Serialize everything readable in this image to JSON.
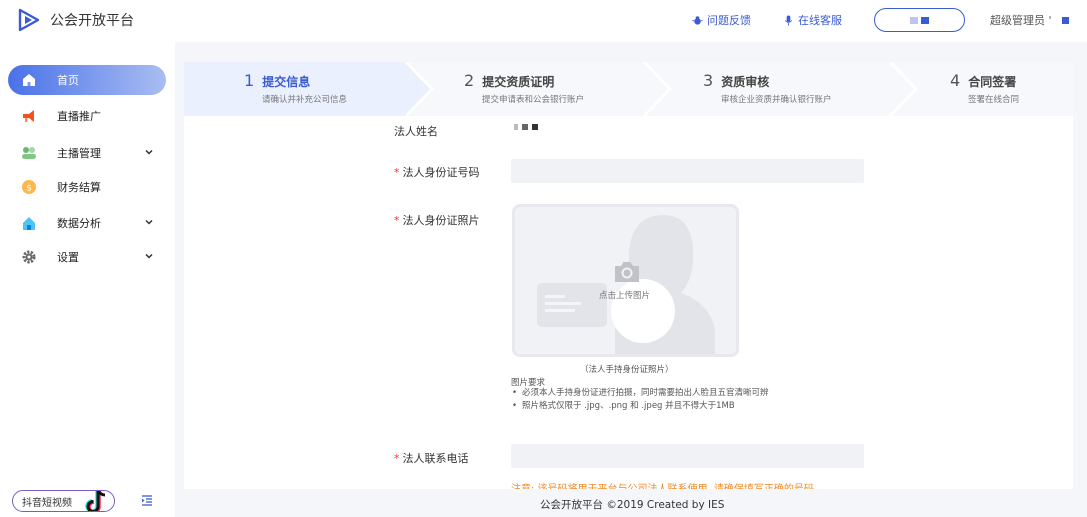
{
  "header": {
    "brand": "公会开放平台",
    "feedback": "问题反馈",
    "service": "在线客服",
    "user": "超级管理员 '"
  },
  "sidebar": {
    "items": [
      {
        "label": "首页",
        "icon": "home-icon"
      },
      {
        "label": "直播推广",
        "icon": "megaphone-icon"
      },
      {
        "label": "主播管理",
        "icon": "users-icon"
      },
      {
        "label": "财务结算",
        "icon": "coin-icon"
      },
      {
        "label": "数据分析",
        "icon": "chart-house-icon"
      },
      {
        "label": "设置",
        "icon": "gear-icon"
      }
    ],
    "douyin": "抖音短视频"
  },
  "steps": [
    {
      "num": "1",
      "title": "提交信息",
      "sub": "请确认并补充公司信息"
    },
    {
      "num": "2",
      "title": "提交资质证明",
      "sub": "提交申请表和公会银行账户"
    },
    {
      "num": "3",
      "title": "资质审核",
      "sub": "审核企业资质并确认银行账户"
    },
    {
      "num": "4",
      "title": "合同签署",
      "sub": "签署在线合同"
    }
  ],
  "form": {
    "name_label": "法人姓名",
    "id_label": "法人身份证号码",
    "photo_label": "法人身份证照片",
    "upload_text": "点击上传图片",
    "photo_caption": "（法人手持身份证照片）",
    "req_title": "图片要求",
    "req_items": [
      "必须本人手持身份证进行拍摄，同时需要拍出人脸且五官清晰可辨",
      "照片格式仅限于 .jpg、.png 和 .jpeg 并且不得大于1MB"
    ],
    "phone_label": "法人联系电话",
    "note": "注意: 该号码将用于平台与公司法人联系使用, 请确保填写正确的号码"
  },
  "footer": "公会开放平台 ©2019 Created by IES",
  "colors": {
    "accent": "#3b5bd1",
    "required": "#e53935",
    "warning": "#f08a24"
  }
}
